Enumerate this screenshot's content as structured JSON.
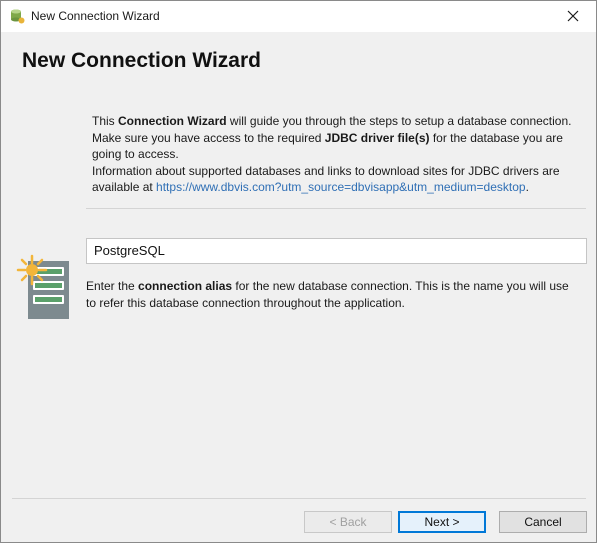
{
  "window": {
    "title": "New Connection Wizard",
    "close_icon": "close-icon",
    "app_icon": "dbvisualizer-icon"
  },
  "main": {
    "heading": "New Connection Wizard",
    "intro": {
      "p1_a": "This ",
      "p1_b": "Connection Wizard",
      "p1_c": " will guide you through the steps to setup a database connection.",
      "p2_a": "Make sure you have access to the required ",
      "p2_b": "JDBC driver file(s)",
      "p2_c": " for the database you are going to access.",
      "p3_a": "Information about supported databases and links to download sites for JDBC drivers are available at ",
      "p3_link": "https://www.dbvis.com?utm_source=dbvisapp&utm_medium=desktop",
      "p3_end": "."
    },
    "alias_input": {
      "value": "PostgreSQL"
    },
    "alias_help": {
      "a": "Enter the ",
      "b": "connection alias",
      "c": " for the new database connection. This is the name you will use to refer this database connection throughout the application."
    },
    "db_icon": "new-database-icon"
  },
  "footer": {
    "back_label": "< Back",
    "next_label": "Next >",
    "cancel_label": "Cancel"
  },
  "colors": {
    "link": "#2f6fb5",
    "accent": "#0078d7",
    "icon_green": "#5aa06a",
    "icon_gray": "#7d8a8f",
    "spark": "#f2b53a"
  }
}
